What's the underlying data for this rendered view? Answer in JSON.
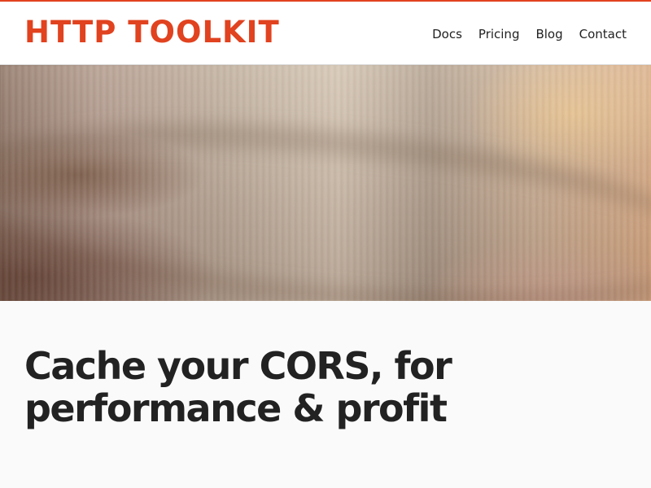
{
  "brand": {
    "logo_text": "HTTP TOOLKIT",
    "accent_color": "#e1421f"
  },
  "navigation": {
    "items": [
      {
        "label": "Docs"
      },
      {
        "label": "Pricing"
      },
      {
        "label": "Blog"
      },
      {
        "label": "Contact"
      }
    ]
  },
  "article": {
    "title": "Cache your CORS, for performance & profit"
  },
  "colors": {
    "header_background": "#ffffff",
    "page_background": "#fafafa",
    "text": "#222222"
  }
}
